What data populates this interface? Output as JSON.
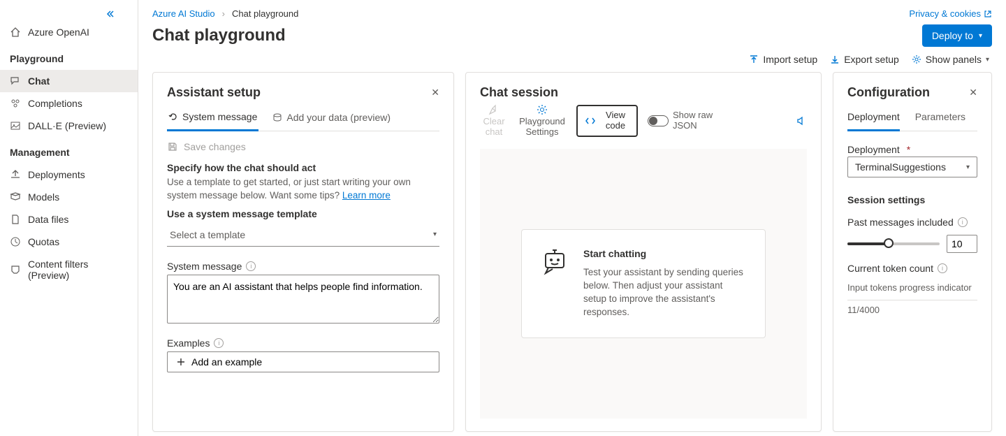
{
  "breadcrumb": {
    "root": "Azure AI Studio",
    "current": "Chat playground"
  },
  "privacy_link": "Privacy & cookies",
  "page_title": "Chat playground",
  "deploy_button": "Deploy to",
  "toolbar": {
    "import": "Import setup",
    "export": "Export setup",
    "panels": "Show panels"
  },
  "sidebar": {
    "top_item": "Azure OpenAI",
    "section_playground": "Playground",
    "items_playground": [
      "Chat",
      "Completions",
      "DALL·E (Preview)"
    ],
    "section_management": "Management",
    "items_management": [
      "Deployments",
      "Models",
      "Data files",
      "Quotas",
      "Content filters (Preview)"
    ]
  },
  "setup": {
    "title": "Assistant setup",
    "tab_system": "System message",
    "tab_data": "Add your data (preview)",
    "save": "Save changes",
    "specify_h": "Specify how the chat should act",
    "specify_p1": "Use a template to get started, or just start writing your own system message below. Want some tips? ",
    "learn_more": "Learn more",
    "use_template_h": "Use a system message template",
    "template_placeholder": "Select a template",
    "system_msg_label": "System message",
    "system_msg_value": "You are an AI assistant that helps people find information.",
    "examples_label": "Examples",
    "add_example": "Add an example"
  },
  "session": {
    "title": "Chat session",
    "clear": "Clear chat",
    "settings": "Playground Settings",
    "view_code": "View code",
    "raw_json": "Show raw JSON",
    "start_h": "Start chatting",
    "start_p": "Test your assistant by sending queries below. Then adjust your assistant setup to improve the assistant's responses."
  },
  "config": {
    "title": "Configuration",
    "tab_deployment": "Deployment",
    "tab_parameters": "Parameters",
    "deployment_label": "Deployment",
    "deployment_value": "TerminalSuggestions",
    "session_h": "Session settings",
    "past_label": "Past messages included",
    "past_value": "10",
    "slider_percent": 45,
    "token_label": "Current token count",
    "token_indicator": "Input tokens progress indicator",
    "token_value": "11/4000"
  }
}
